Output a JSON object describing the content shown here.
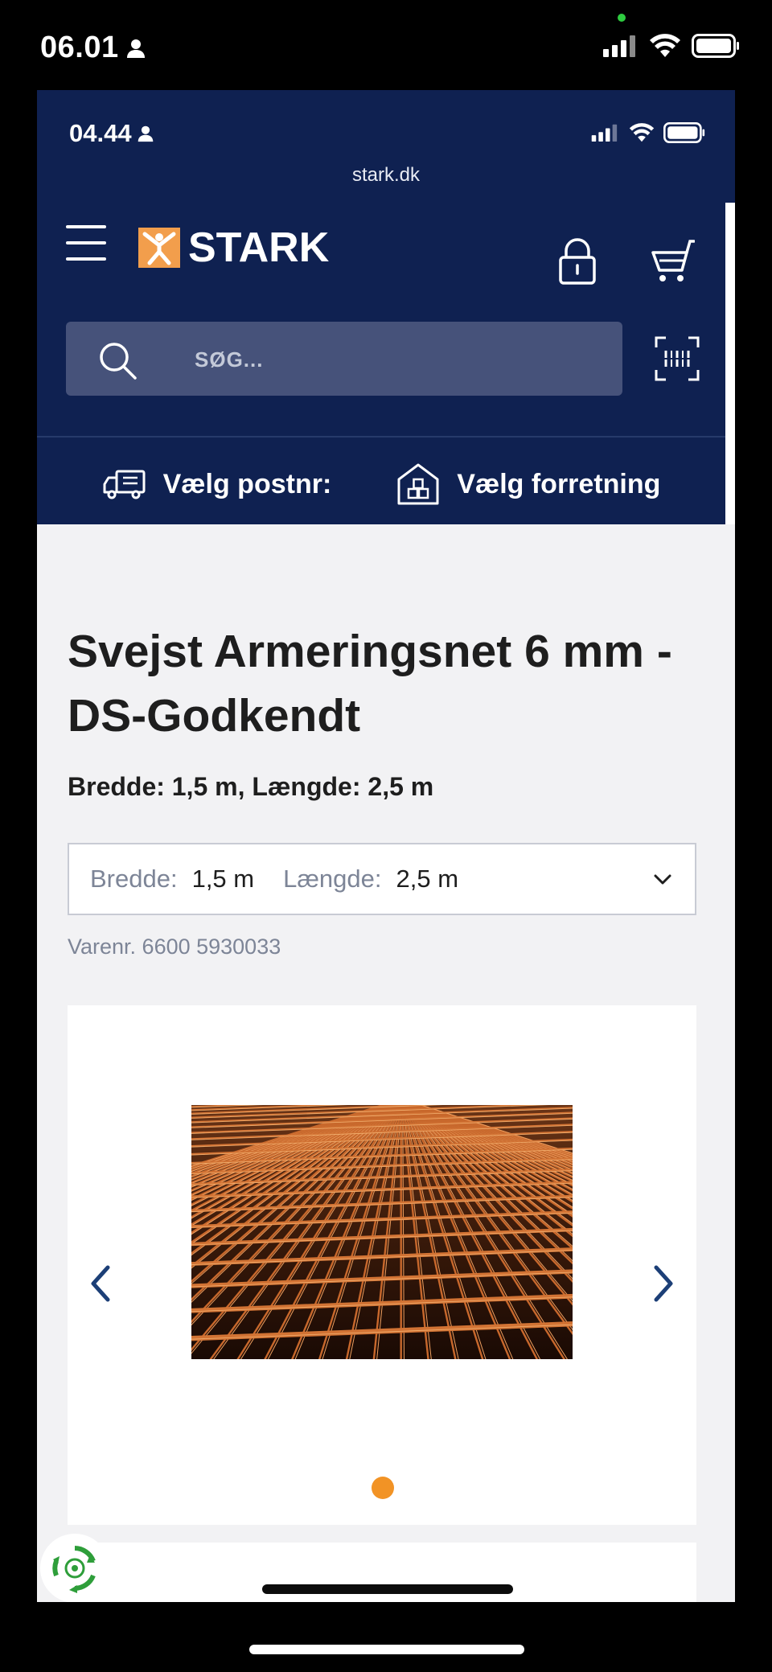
{
  "outer_status": {
    "time": "06.01"
  },
  "inner_status": {
    "time": "04.44",
    "url": "stark.dk"
  },
  "header": {
    "logo_text": "STARK",
    "search_placeholder": "SØG...",
    "postal": "Vælg postnr:",
    "store": "Vælg forretning"
  },
  "product": {
    "title": "Svejst Armeringsnet 6 mm - DS-Godkendt",
    "subtitle": "Bredde: 1,5 m, Længde: 2,5 m",
    "variant": {
      "width_label": "Bredde:",
      "width_value": "1,5 m",
      "length_label": "Længde:",
      "length_value": "2,5 m"
    },
    "sku": "Varenr. 6600 5930033"
  },
  "colors": {
    "brand_navy": "#0f2151",
    "brand_orange": "#f29e4c",
    "indicator_orange": "#f29325"
  },
  "icons": [
    "person-icon",
    "signal-icon",
    "wifi-icon",
    "battery-icon",
    "menu-icon",
    "lock-icon",
    "cart-icon",
    "search-icon",
    "barcode-scan-icon",
    "truck-icon",
    "store-icon",
    "chevron-down-icon",
    "chevron-left-icon",
    "chevron-right-icon",
    "eco-recycle-icon"
  ]
}
